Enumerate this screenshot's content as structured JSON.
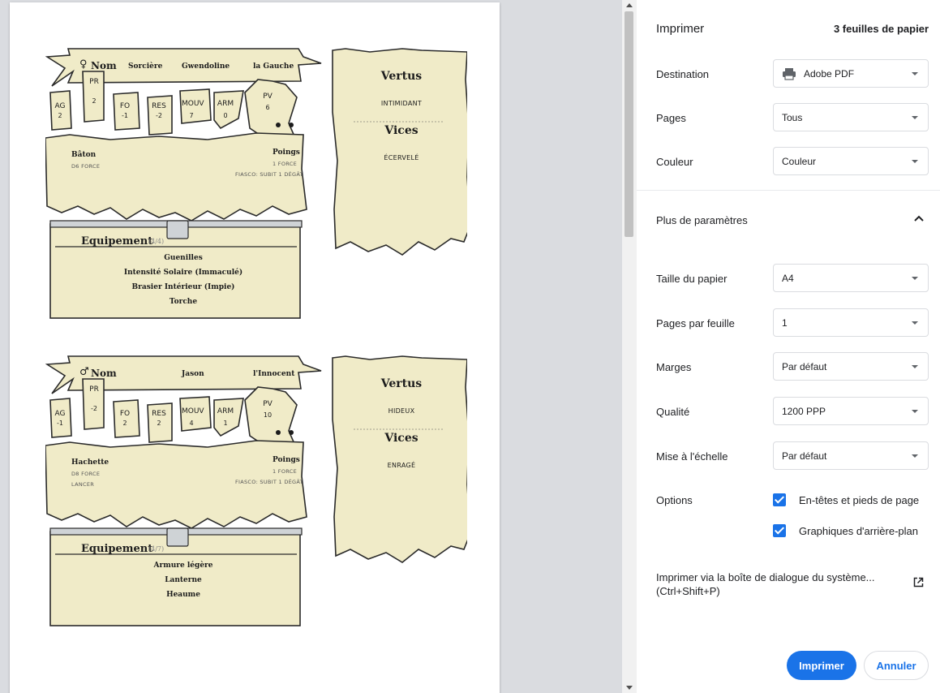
{
  "panel": {
    "title": "Imprimer",
    "sheets": "3 feuilles de papier",
    "destination": {
      "label": "Destination",
      "value": "Adobe PDF"
    },
    "pages": {
      "label": "Pages",
      "value": "Tous"
    },
    "color": {
      "label": "Couleur",
      "value": "Couleur"
    },
    "more": {
      "label": "Plus de paramètres"
    },
    "paper_size": {
      "label": "Taille du papier",
      "value": "A4"
    },
    "pages_per_sheet": {
      "label": "Pages par feuille",
      "value": "1"
    },
    "margins": {
      "label": "Marges",
      "value": "Par défaut"
    },
    "quality": {
      "label": "Qualité",
      "value": "1200 PPP"
    },
    "scaling": {
      "label": "Mise à l'échelle",
      "value": "Par défaut"
    },
    "options": {
      "label": "Options",
      "headers_footers": "En-têtes et pieds de page",
      "background_graphics": "Graphiques d'arrière-plan"
    },
    "system_dialog": {
      "line1": "Imprimer via la boîte de dialogue du système...",
      "line2": "(Ctrl+Shift+P)"
    },
    "print_button": "Imprimer",
    "cancel_button": "Annuler"
  },
  "cards": [
    {
      "gender": "♀",
      "name_label": "Nom",
      "class": "Sorcière",
      "name": "Gwendoline",
      "epithet": "la Gauche",
      "stats": [
        {
          "label": "AG",
          "value": "2"
        },
        {
          "label": "PR",
          "value": "2"
        },
        {
          "label": "FO",
          "value": "-1"
        },
        {
          "label": "RES",
          "value": "-2"
        },
        {
          "label": "MOUV",
          "value": "7"
        },
        {
          "label": "ARM",
          "value": "0"
        },
        {
          "label": "PV",
          "value": "6"
        }
      ],
      "weapon_left": {
        "name": "Bâton",
        "lines": [
          "D6 FORCE"
        ]
      },
      "weapon_right": {
        "name": "Poings",
        "lines": [
          "1 FORCE",
          "FIASCO: SUBIT 1 DÉGÂT"
        ]
      },
      "equipment_title": "Equipement",
      "equipment_count": "(4/4)",
      "equipment": [
        "Guenilles",
        "Intensité Solaire (Immaculé)",
        "Brasier Intérieur (Impie)",
        "Torche"
      ],
      "virtues_title": "Vertus",
      "virtue": "INTIMIDANT",
      "vices_title": "Vices",
      "vice": "ÉCERVELÉ"
    },
    {
      "gender": "♂",
      "name_label": "Nom",
      "class": "",
      "name": "Jason",
      "epithet": "l'Innocent",
      "stats": [
        {
          "label": "AG",
          "value": "-1"
        },
        {
          "label": "PR",
          "value": "-2"
        },
        {
          "label": "FO",
          "value": "2"
        },
        {
          "label": "RES",
          "value": "2"
        },
        {
          "label": "MOUV",
          "value": "4"
        },
        {
          "label": "ARM",
          "value": "1"
        },
        {
          "label": "PV",
          "value": "10"
        }
      ],
      "weapon_left": {
        "name": "Hachette",
        "lines": [
          "D8 FORCE",
          "LANCER"
        ]
      },
      "weapon_right": {
        "name": "Poings",
        "lines": [
          "1 FORCE",
          "FIASCO: SUBIT 1 DÉGÂT"
        ]
      },
      "equipment_title": "Equipement",
      "equipment_count": "(4/7)",
      "equipment": [
        "Armure légère",
        "Lanterne",
        "Heaume"
      ],
      "virtues_title": "Vertus",
      "virtue": "HIDEUX",
      "vices_title": "Vices",
      "vice": "ENRAGÉ"
    }
  ]
}
